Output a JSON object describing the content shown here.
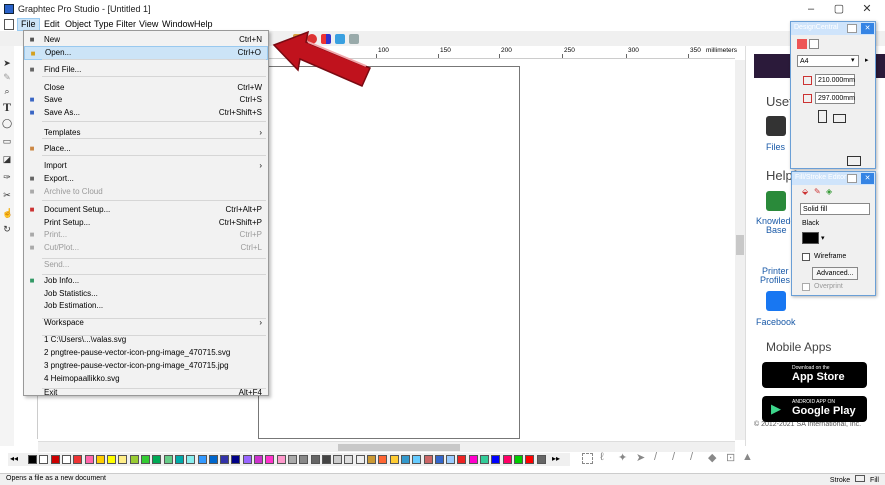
{
  "window": {
    "title": "Graphtec Pro Studio - [Untitled 1]",
    "controls": [
      "–",
      "▢",
      "✕"
    ]
  },
  "menubar": {
    "items": [
      "File",
      "Edit",
      "Object",
      "Type",
      "Filter",
      "View",
      "Window",
      "Help"
    ],
    "active": "File"
  },
  "ruler": {
    "labels": [
      "100",
      "150",
      "200",
      "250",
      "300",
      "350"
    ],
    "unit": "millimeters"
  },
  "file_menu": {
    "rows": [
      {
        "label": "New",
        "shortcut": "Ctrl+N",
        "icon": "new-doc-icon",
        "disabled": false
      },
      {
        "label": "Open...",
        "shortcut": "Ctrl+O",
        "icon": "open-folder-icon",
        "disabled": false,
        "highlighted": true
      },
      {
        "label": "Find File...",
        "shortcut": "",
        "icon": "find-file-icon",
        "disabled": false
      },
      {
        "label": "Close",
        "shortcut": "Ctrl+W",
        "icon": "",
        "disabled": false
      },
      {
        "label": "Save",
        "shortcut": "Ctrl+S",
        "icon": "save-icon",
        "disabled": false
      },
      {
        "label": "Save As...",
        "shortcut": "Ctrl+Shift+S",
        "icon": "save-as-icon",
        "disabled": false
      },
      {
        "label": "Templates",
        "shortcut": "",
        "submenu": true,
        "disabled": false
      },
      {
        "label": "Place...",
        "shortcut": "",
        "icon": "place-icon",
        "disabled": false
      },
      {
        "label": "Import",
        "shortcut": "",
        "submenu": true,
        "disabled": false
      },
      {
        "label": "Export...",
        "shortcut": "",
        "icon": "export-icon",
        "disabled": false
      },
      {
        "label": "Archive to Cloud",
        "shortcut": "",
        "icon": "cloud-icon",
        "disabled": true
      },
      {
        "label": "Document Setup...",
        "shortcut": "Ctrl+Alt+P",
        "icon": "document-setup-icon",
        "disabled": false
      },
      {
        "label": "Print Setup...",
        "shortcut": "Ctrl+Shift+P",
        "icon": "",
        "disabled": false
      },
      {
        "label": "Print...",
        "shortcut": "Ctrl+P",
        "icon": "print-icon",
        "disabled": true
      },
      {
        "label": "Cut/Plot...",
        "shortcut": "Ctrl+L",
        "icon": "cut-plot-icon",
        "disabled": true
      },
      {
        "label": "Send...",
        "shortcut": "",
        "icon": "",
        "disabled": true
      },
      {
        "label": "Job Info...",
        "shortcut": "",
        "icon": "job-info-icon",
        "disabled": false
      },
      {
        "label": "Job Statistics...",
        "shortcut": "",
        "icon": "",
        "disabled": false
      },
      {
        "label": "Job Estimation...",
        "shortcut": "",
        "icon": "",
        "disabled": false
      },
      {
        "label": "Workspace",
        "shortcut": "",
        "submenu": true,
        "disabled": false
      },
      {
        "label": "1 C:\\Users\\...\\valas.svg",
        "shortcut": "",
        "icon": "",
        "disabled": false
      },
      {
        "label": "2 pngtree-pause-vector-icon-png-image_470715.svg",
        "shortcut": "",
        "icon": "",
        "disabled": false
      },
      {
        "label": "3 pngtree-pause-vector-icon-png-image_470715.jpg",
        "shortcut": "",
        "icon": "",
        "disabled": false
      },
      {
        "label": "4 Heimopaallikko.svg",
        "shortcut": "",
        "icon": "",
        "disabled": false
      },
      {
        "label": "Exit",
        "shortcut": "Alt+F4",
        "icon": "",
        "disabled": false
      }
    ]
  },
  "welcome_panel": {
    "useful": "Usefu",
    "files": "Files",
    "helpful": "Helpf",
    "knowledge_base": [
      "Knowledg",
      "Base"
    ],
    "printer_profiles": [
      "Printer",
      "Profiles"
    ],
    "facebook": "Facebook",
    "mobile_apps": "Mobile Apps",
    "app_store_small": "Download on the",
    "app_store": "App Store",
    "google_play_small": "ANDROID APP ON",
    "google_play": "Google Play",
    "copyright": "© 2012-2021 SA International, Inc."
  },
  "design_central": {
    "title": "DesignCentral",
    "paper": "A4",
    "width": "210.000mm",
    "height": "297.000mm"
  },
  "fill_stroke": {
    "title": "Fill/Stroke Editor",
    "fill_type": "Solid fill",
    "color_name": "Black",
    "wireframe": "Wireframe",
    "advanced": "Advanced...",
    "overprint": "Overprint"
  },
  "status": {
    "text": "Opens a file as a new document",
    "right": "Stroke",
    "fill": "Fill"
  },
  "colors": {
    "accent": "#0078d7",
    "arrow_red": "#c0121d",
    "menu_highlight": "#cce4f7"
  }
}
